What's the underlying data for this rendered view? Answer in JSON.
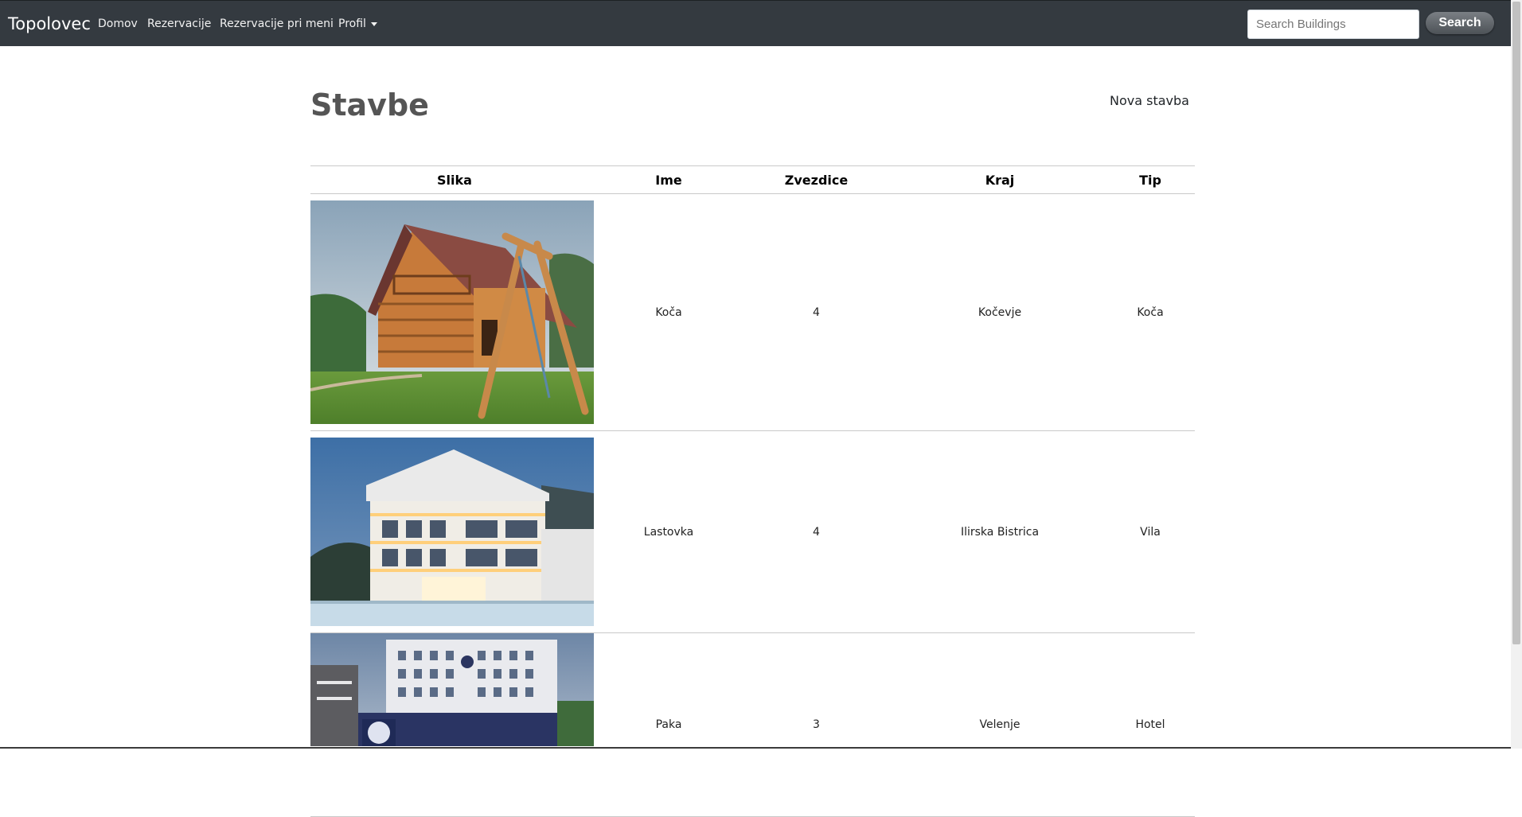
{
  "navbar": {
    "brand": "Topolovec",
    "links": [
      {
        "label": "Domov"
      },
      {
        "label": "Rezervacije"
      },
      {
        "label": "Rezervacije pri meni"
      },
      {
        "label": "Profil"
      }
    ],
    "search": {
      "placeholder": "Search Buildings",
      "value": "",
      "button_label": "Search"
    }
  },
  "page": {
    "title": "Stavbe",
    "new_link": "Nova stavba"
  },
  "table": {
    "headers": [
      "Slika",
      "Ime",
      "Zvezdice",
      "Kraj",
      "Tip"
    ],
    "rows": [
      {
        "image": "log-cabin-photo",
        "name": "Koča",
        "stars": "4",
        "place": "Kočevje",
        "type": "Koča"
      },
      {
        "image": "villa-photo",
        "name": "Lastovka",
        "stars": "4",
        "place": "Ilirska Bistrica",
        "type": "Vila"
      },
      {
        "image": "hotel-photo",
        "name": "Paka",
        "stars": "3",
        "place": "Velenje",
        "type": "Hotel"
      }
    ]
  },
  "colors": {
    "navbar_bg": "#343a40",
    "title": "#555555",
    "border": "#c9c9c9"
  }
}
